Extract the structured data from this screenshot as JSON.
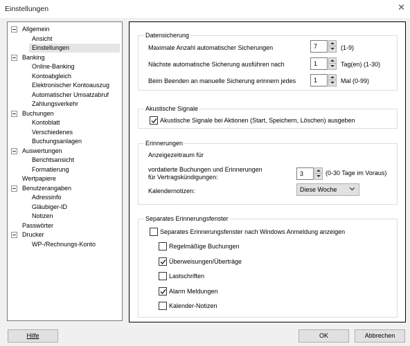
{
  "window": {
    "title": "Einstellungen"
  },
  "tree": {
    "items": [
      {
        "label": "Allgemein",
        "level": 0
      },
      {
        "label": "Ansicht",
        "level": 1
      },
      {
        "label": "Einstellungen",
        "level": 1,
        "selected": true
      },
      {
        "label": "Banking",
        "level": 0
      },
      {
        "label": "Online-Banking",
        "level": 1
      },
      {
        "label": "Kontoabgleich",
        "level": 1
      },
      {
        "label": "Elektronischer Kontoauszug",
        "level": 1
      },
      {
        "label": "Automatischer Umsatzabruf",
        "level": 1
      },
      {
        "label": "Zahlungsverkehr",
        "level": 1
      },
      {
        "label": "Buchungen",
        "level": 0
      },
      {
        "label": "Kontoblatt",
        "level": 1
      },
      {
        "label": "Verschiedenes",
        "level": 1
      },
      {
        "label": "Buchungsanlagen",
        "level": 1
      },
      {
        "label": "Auswertungen",
        "level": 0
      },
      {
        "label": "Berichtsansicht",
        "level": 1
      },
      {
        "label": "Formatierung",
        "level": 1
      },
      {
        "label": "Wertpapiere",
        "level": 0
      },
      {
        "label": "Benutzerangaben",
        "level": 0
      },
      {
        "label": "Adressinfo",
        "level": 1
      },
      {
        "label": "Gläubiger-ID",
        "level": 1
      },
      {
        "label": "Notizen",
        "level": 1
      },
      {
        "label": "Passwörter",
        "level": 0
      },
      {
        "label": "Drucker",
        "level": 0
      },
      {
        "label": "WP-/Rechnungs-Konto",
        "level": 1
      }
    ]
  },
  "datensicherung": {
    "legend": "Datensicherung",
    "max_label": "Maximale Anzahl automatischer Sicherungen",
    "max_value": "7",
    "max_range": "(1-9)",
    "next_label": "Nächste automatische Sicherung ausführen nach",
    "next_value": "1",
    "next_range": "Tag(en) (1-30)",
    "remind_label": "Beim Beenden an manuelle Sicherung erinnern jedes",
    "remind_value": "1",
    "remind_range": "Mal (0-99)"
  },
  "akustisch": {
    "legend": "Akustische Signale",
    "checkbox_label": "Akustische Signale bei Aktionen (Start, Speichern, Löschen) ausgeben",
    "checked": true
  },
  "erinnerungen": {
    "legend": "Erinnerungen",
    "period_label": "Anzeigezeitraum für",
    "vordatiert_line1": "vordatierte Buchungen und Erinnerungen",
    "vordatiert_line2": "für Vertragskündigungen:",
    "days_value": "3",
    "days_range": "(0-30 Tage im Voraus)",
    "kalender_label": "Kalendernotizen:",
    "kalender_value": "Diese Woche"
  },
  "fenster": {
    "legend": "Separates Erinnerungsfenster",
    "main_label": "Separates Erinnerungsfenster nach Windows Anmeldung anzeigen",
    "main_checked": false,
    "options": [
      {
        "label": "Regelmäßige Buchungen",
        "checked": false
      },
      {
        "label": "Überweisungen/Überträge",
        "checked": true
      },
      {
        "label": "Lastschriften",
        "checked": false
      },
      {
        "label": "Alarm Meldungen",
        "checked": true
      },
      {
        "label": "Kalender-Notizen",
        "checked": false
      }
    ]
  },
  "buttons": {
    "help": "Hilfe",
    "ok": "OK",
    "cancel": "Abbrechen"
  }
}
